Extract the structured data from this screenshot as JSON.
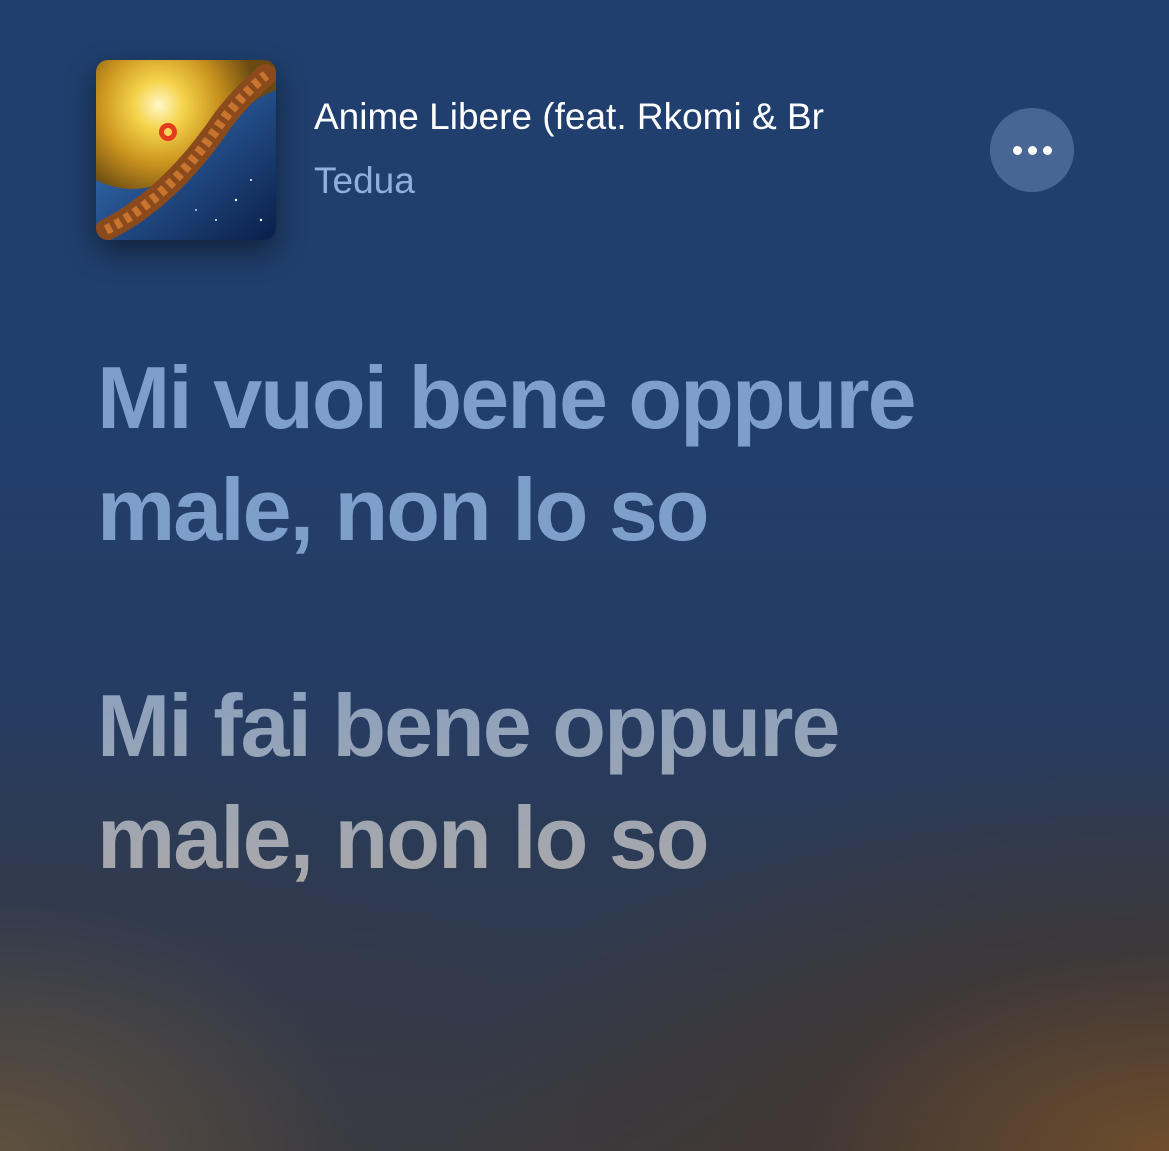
{
  "now_playing": {
    "title": "Anime Libere (feat. Rkomi & Br",
    "artist": "Tedua",
    "artwork_icon": "album-artwork"
  },
  "more_button": {
    "icon": "ellipsis-icon"
  },
  "lyrics": {
    "lines": [
      "Mi vuoi bene oppure male, non lo so",
      "Mi fai bene oppure male, non lo so"
    ]
  },
  "colors": {
    "background_top": "#1f3f6e",
    "background_bottom_accent": "#785028",
    "lyric_active": "#7f9fcb",
    "artist_text": "#8fb0dc"
  }
}
